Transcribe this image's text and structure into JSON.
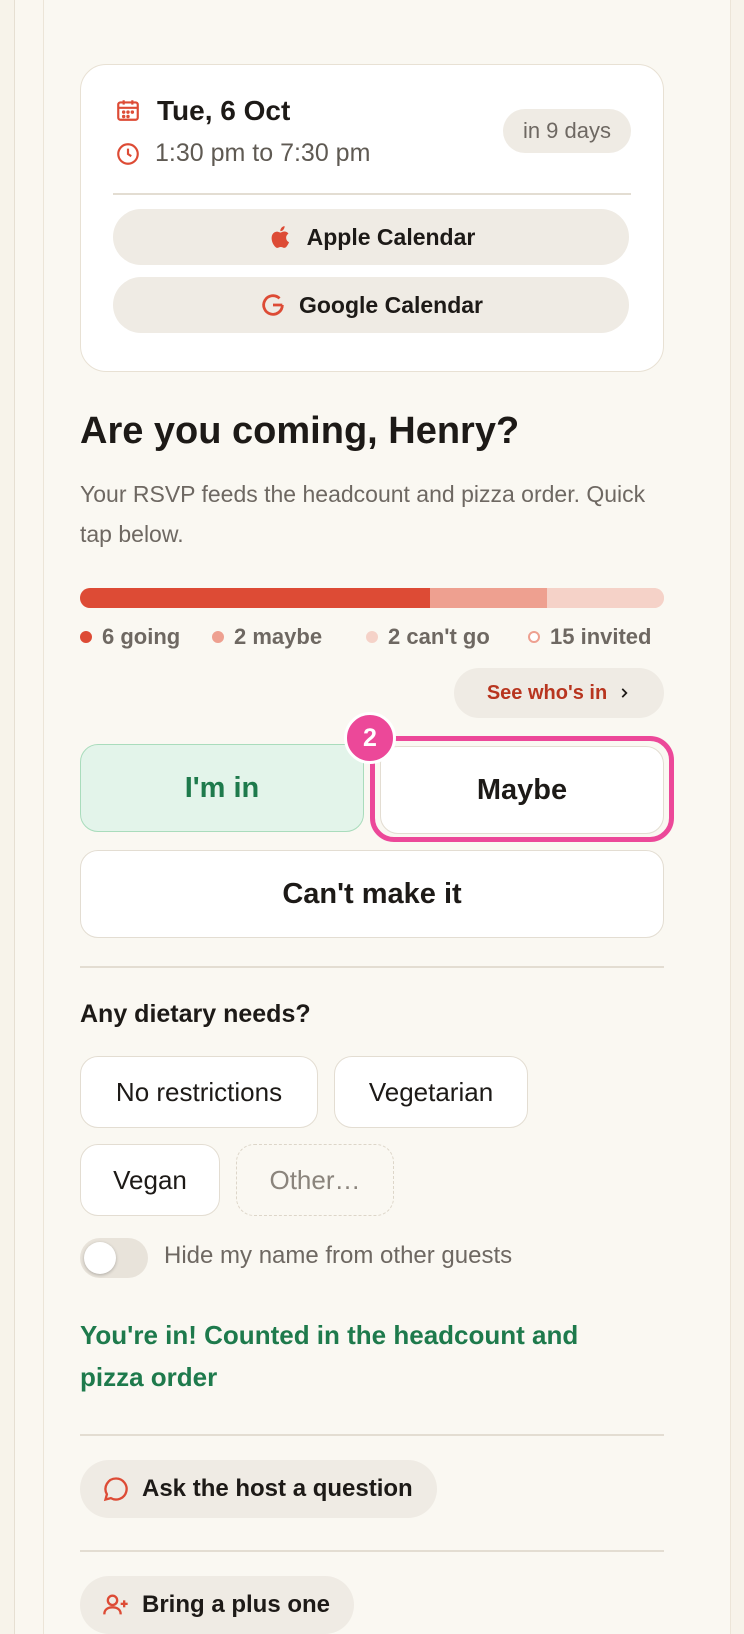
{
  "event": {
    "date": "Tue, 6 Oct",
    "time": "1:30 pm to 7:30 pm",
    "countdown": "in 9 days"
  },
  "calendar_buttons": {
    "apple": "Apple Calendar",
    "google": "Google Calendar"
  },
  "rsvp": {
    "heading": "Are you coming, Henry?",
    "subtext": "Your RSVP feeds the headcount and pizza order. Quick tap below.",
    "headcount": {
      "going": 6,
      "maybe": 2,
      "cant_go": 2,
      "invited": 15,
      "going_label": "6 going",
      "maybe_label": "2 maybe",
      "cant_label": "2 can't go",
      "invited_label": "15 invited"
    },
    "see_whos_in": "See who's in",
    "buttons": {
      "in": "I'm in",
      "maybe": "Maybe",
      "cant": "Can't make it"
    },
    "step_badge": "2"
  },
  "dietary": {
    "label": "Any dietary needs?",
    "options": [
      "No restrictions",
      "Vegetarian",
      "Vegan",
      "Other…"
    ]
  },
  "privacy_toggle": {
    "label": "Hide my name from other guests",
    "on": false
  },
  "confirmation": "You're in! Counted in the headcount and pizza order",
  "actions": {
    "ask_host": "Ask the host a question",
    "plus_one": "Bring a plus one"
  },
  "colors": {
    "accent": "#dd4b35",
    "success": "#1e7a4c",
    "highlight": "#ec4899"
  }
}
